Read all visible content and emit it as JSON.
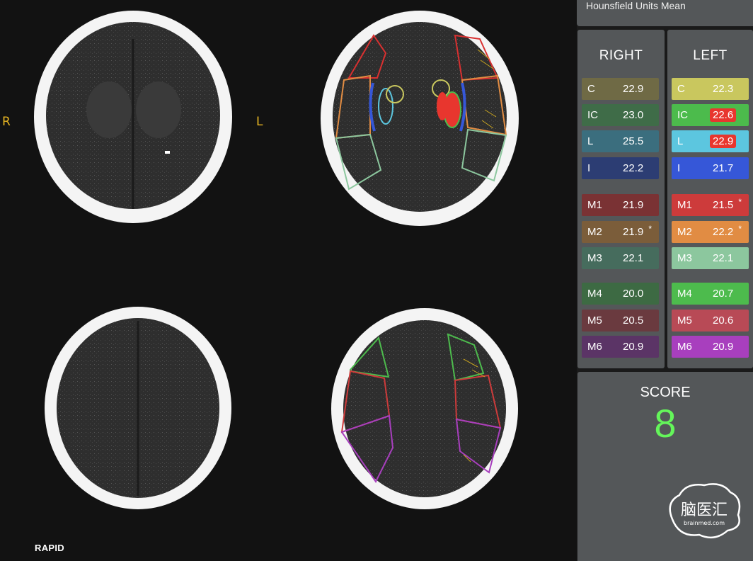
{
  "viewer": {
    "side_right": "R",
    "side_left": "L",
    "brand": "RAPID"
  },
  "panel": {
    "header": "Hounsfield Units Mean",
    "right_title": "RIGHT",
    "left_title": "LEFT",
    "right": [
      {
        "label": "C",
        "value": "22.9",
        "flag": false,
        "asterisk": "",
        "color": "#6f6a45"
      },
      {
        "label": "IC",
        "value": "23.0",
        "flag": false,
        "asterisk": "",
        "color": "#3f6c48"
      },
      {
        "label": "L",
        "value": "25.5",
        "flag": false,
        "asterisk": "",
        "color": "#3b6e7e"
      },
      {
        "label": "I",
        "value": "22.2",
        "flag": false,
        "asterisk": "",
        "color": "#2c3d73"
      },
      {
        "label": "M1",
        "value": "21.9",
        "flag": false,
        "asterisk": "",
        "color": "#7a3234"
      },
      {
        "label": "M2",
        "value": "21.9",
        "flag": false,
        "asterisk": "*",
        "color": "#7b5d3a"
      },
      {
        "label": "M3",
        "value": "22.1",
        "flag": false,
        "asterisk": "",
        "color": "#466c5d"
      },
      {
        "label": "M4",
        "value": "20.0",
        "flag": false,
        "asterisk": "",
        "color": "#3d6a43"
      },
      {
        "label": "M5",
        "value": "20.5",
        "flag": false,
        "asterisk": "",
        "color": "#6a3a3f"
      },
      {
        "label": "M6",
        "value": "20.9",
        "flag": false,
        "asterisk": "",
        "color": "#5b3466"
      }
    ],
    "left": [
      {
        "label": "C",
        "value": "22.3",
        "flag": false,
        "asterisk": "",
        "color": "#c9c75e"
      },
      {
        "label": "IC",
        "value": "22.6",
        "flag": true,
        "asterisk": "",
        "color": "#4cbb4c"
      },
      {
        "label": "L",
        "value": "22.9",
        "flag": true,
        "asterisk": "",
        "color": "#5cc6df"
      },
      {
        "label": "I",
        "value": "21.7",
        "flag": false,
        "asterisk": "",
        "color": "#3657d8"
      },
      {
        "label": "M1",
        "value": "21.5",
        "flag": false,
        "asterisk": "*",
        "color": "#cd3b3b"
      },
      {
        "label": "M2",
        "value": "22.2",
        "flag": false,
        "asterisk": "*",
        "color": "#e18c43"
      },
      {
        "label": "M3",
        "value": "22.1",
        "flag": false,
        "asterisk": "",
        "color": "#8cc79e"
      },
      {
        "label": "M4",
        "value": "20.7",
        "flag": false,
        "asterisk": "",
        "color": "#4dbb4d"
      },
      {
        "label": "M5",
        "value": "20.6",
        "flag": false,
        "asterisk": "",
        "color": "#b84a56"
      },
      {
        "label": "M6",
        "value": "20.9",
        "flag": false,
        "asterisk": "",
        "color": "#a83fbe"
      }
    ],
    "score_label": "SCORE",
    "score_value": "8",
    "logo_text": "脑医汇",
    "logo_subtext": "brainmed.com"
  },
  "colors": {
    "score": "#64f55a",
    "flag": "#e8362e",
    "side_label": "#e6b422"
  }
}
